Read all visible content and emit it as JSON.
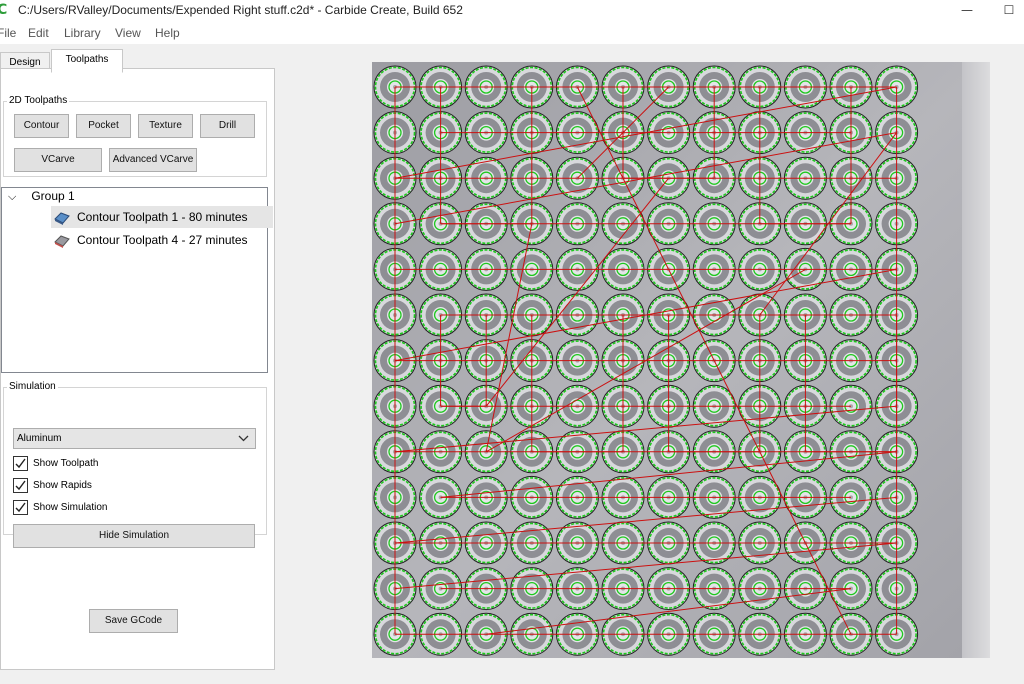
{
  "window": {
    "title": "C:/Users/RValley/Documents/Expended Right stuff.c2d* - Carbide Create, Build 652",
    "app_icon": "C",
    "minimize": "—",
    "maximize": "☐"
  },
  "menu": [
    "File",
    "Edit",
    "Library",
    "View",
    "Help"
  ],
  "tabs": {
    "design": "Design",
    "toolpaths": "Toolpaths"
  },
  "toolpaths_2d": {
    "title": "2D Toolpaths",
    "buttons": [
      "Contour",
      "Pocket",
      "Texture",
      "Drill",
      "VCarve",
      "Advanced VCarve"
    ]
  },
  "tree": {
    "group_label": "Group 1",
    "items": [
      {
        "label": "Contour Toolpath 1 - 80 minutes",
        "selected": true,
        "icon": "toolpath-blue-icon"
      },
      {
        "label": "Contour Toolpath 4 - 27 minutes",
        "selected": false,
        "icon": "toolpath-red-icon"
      }
    ]
  },
  "simulation": {
    "title": "Simulation",
    "material": "Aluminum",
    "show_toolpath": "Show Toolpath",
    "show_rapids": "Show Rapids",
    "show_simulation": "Show Simulation",
    "hide_button": "Hide Simulation"
  },
  "save_gcode": "Save GCode",
  "colors": {
    "contour_green": "#1ec81e",
    "rapid_red": "#cc1010",
    "stock_gray": "#a8a8ac",
    "selection": "#e5e5e5"
  },
  "workpiece": {
    "rows": 13,
    "cols": 12
  }
}
